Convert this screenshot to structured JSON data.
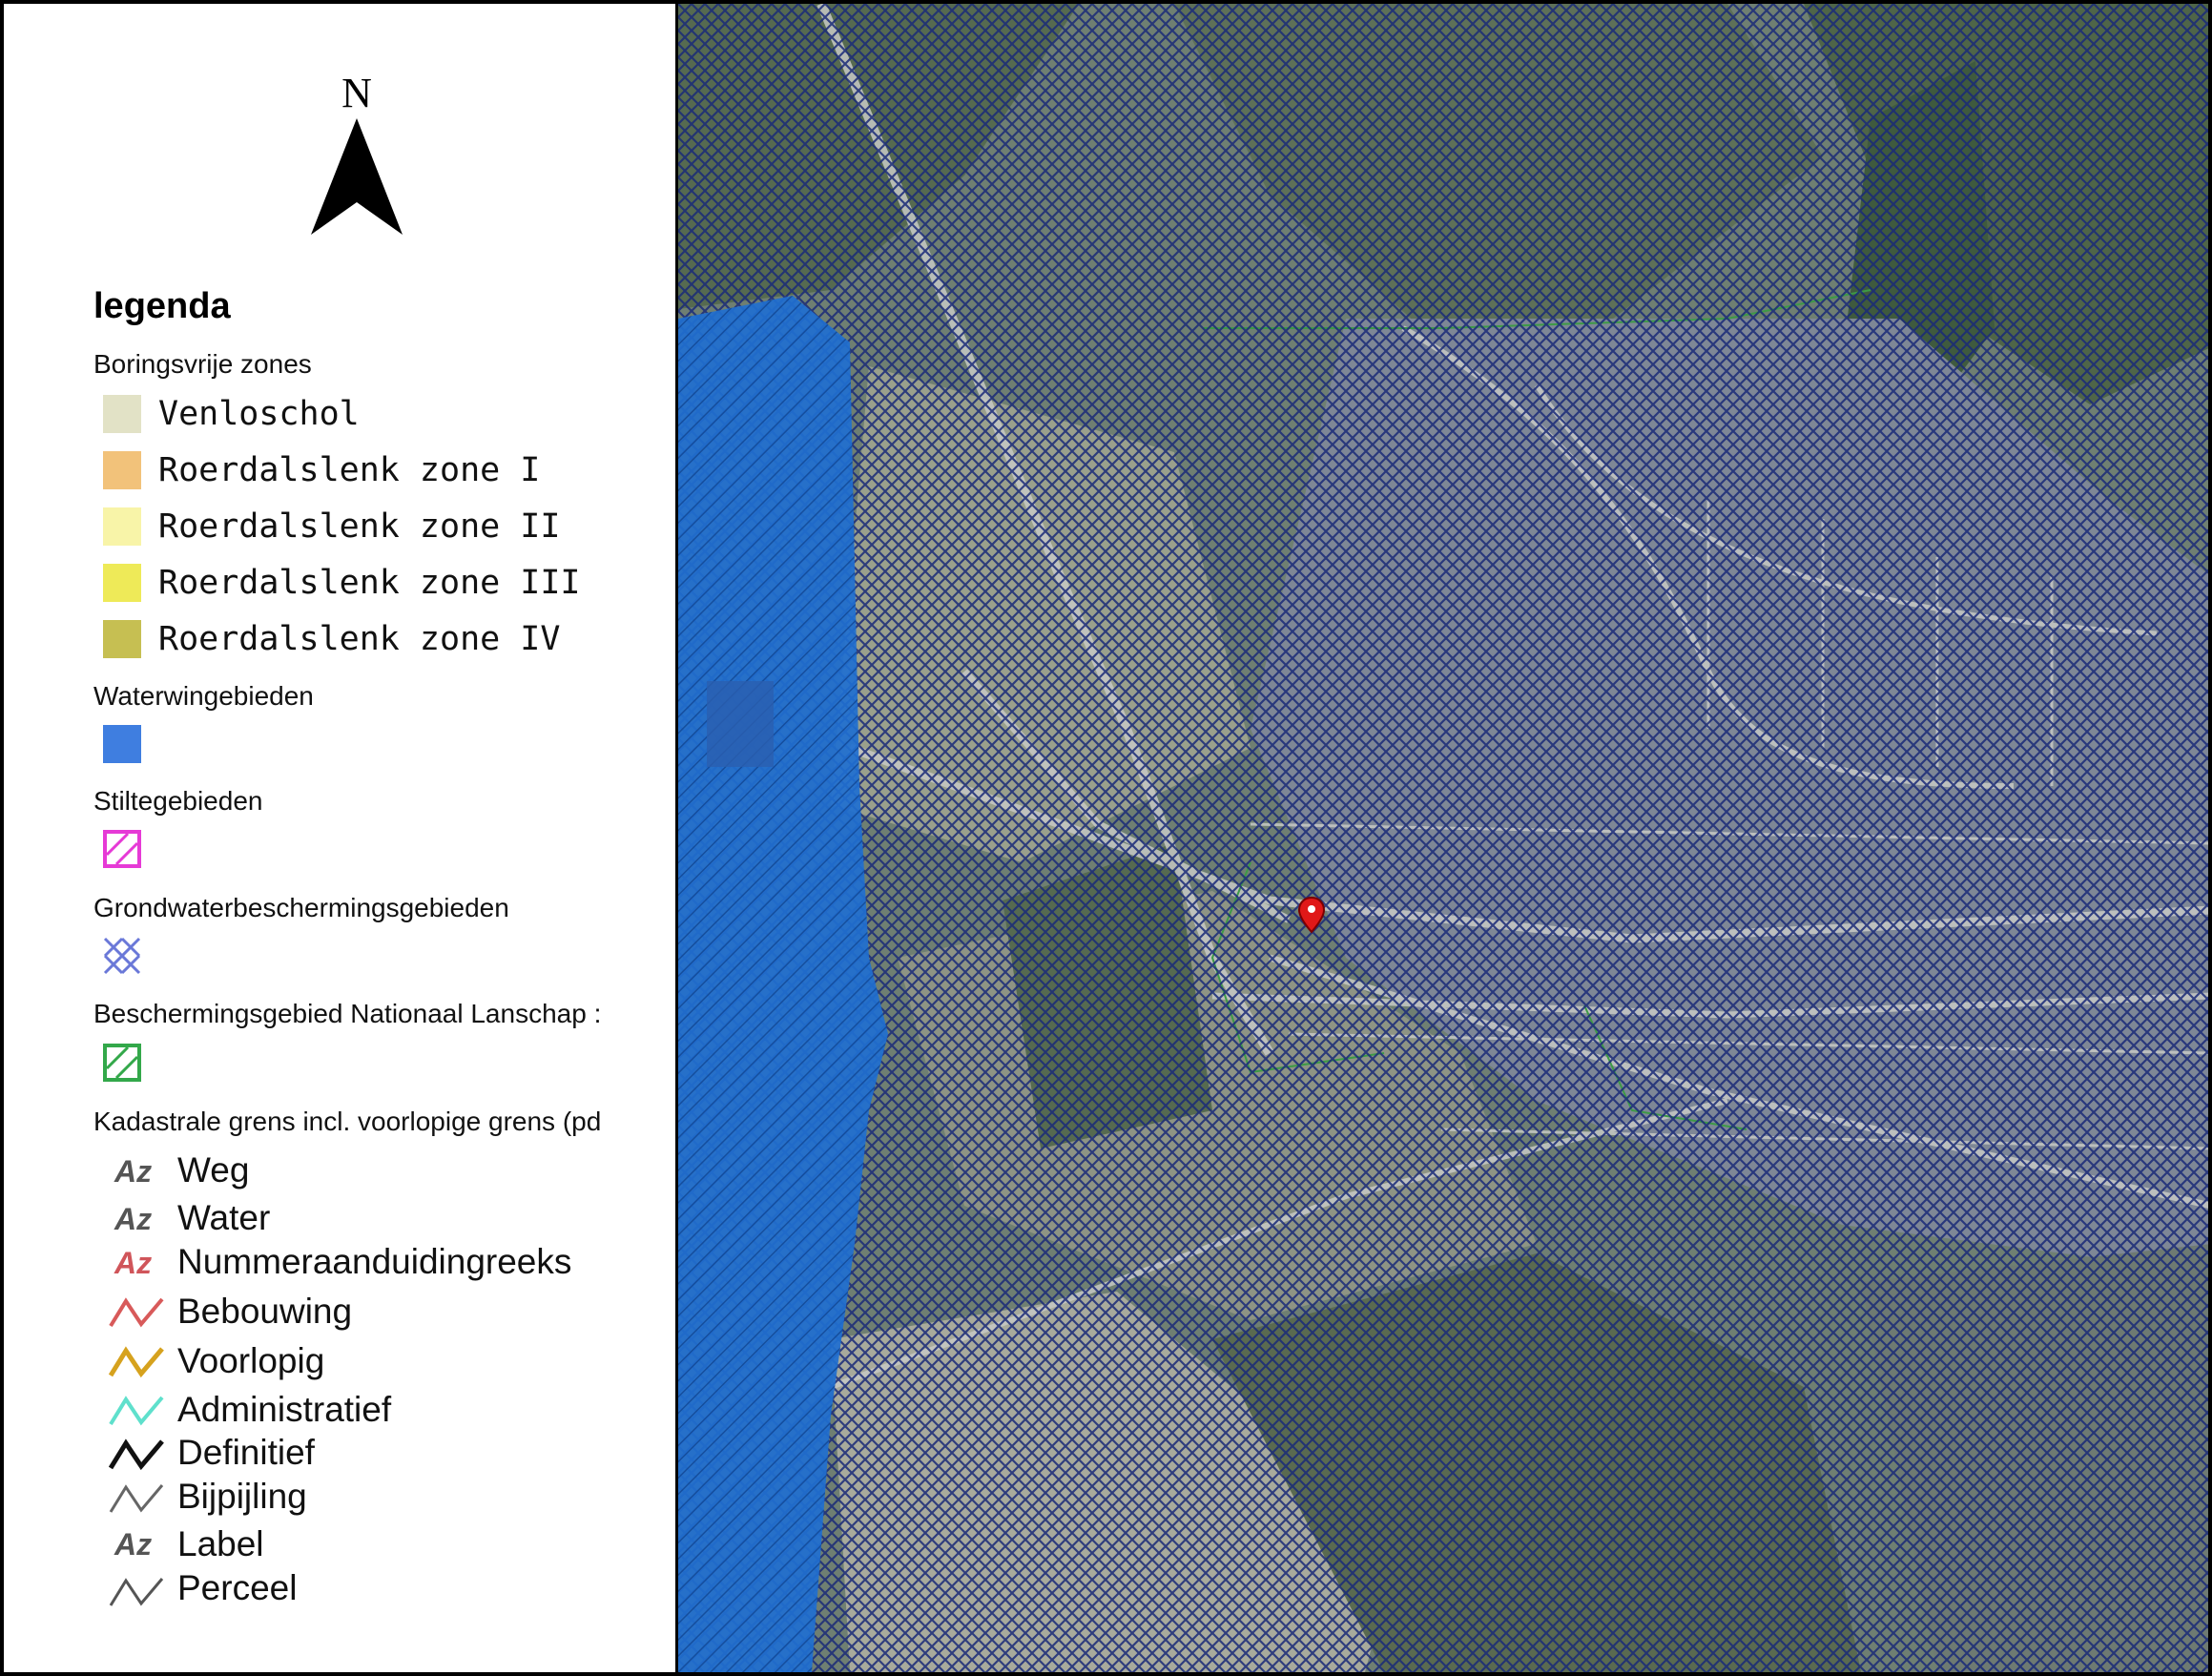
{
  "north_arrow": {
    "label": "N"
  },
  "legend": {
    "title": "legenda",
    "groups": {
      "boringsvrije": {
        "title": "Boringsvrije zones",
        "items": [
          {
            "label": "Venloschol",
            "color": "#e2e2c6"
          },
          {
            "label": "Roerdalslenk zone I",
            "color": "#f2c27a"
          },
          {
            "label": "Roerdalslenk zone II",
            "color": "#f8f4a8"
          },
          {
            "label": "Roerdalslenk zone III",
            "color": "#eeea58"
          },
          {
            "label": "Roerdalslenk zone IV",
            "color": "#c6bf52"
          }
        ]
      },
      "waterwingebieden": {
        "title": "Waterwingebieden",
        "color": "#3f7ee0"
      },
      "stiltegebieden": {
        "title": "Stiltegebieden",
        "color": "#e63ad6"
      },
      "grondwater": {
        "title": "Grondwaterbeschermingsgebieden",
        "color": "#6a78d8"
      },
      "nationaal_landschap": {
        "title": "Beschermingsgebied Nationaal Lanschap :",
        "color": "#33a84a"
      },
      "kadastraal": {
        "title": "Kadastrale grens incl. voorlopige grens (pd",
        "items": [
          {
            "label": "Weg",
            "icon": "az-text-icon",
            "color": "#555555"
          },
          {
            "label": "Water",
            "icon": "az-text-icon",
            "color": "#555555"
          },
          {
            "label": "Nummeraanduidingreeks",
            "icon": "az-text-icon",
            "color": "#d0555a"
          },
          {
            "label": "Bebouwing",
            "icon": "line-icon",
            "color": "#d85a5a"
          },
          {
            "label": "Voorlopig",
            "icon": "line-icon",
            "color": "#d6a21e"
          },
          {
            "label": "Administratief",
            "icon": "line-icon",
            "color": "#5fe0cc"
          },
          {
            "label": "Definitief",
            "icon": "line-icon",
            "color": "#111111"
          },
          {
            "label": "Bijpijling",
            "icon": "line-icon",
            "color": "#666666"
          },
          {
            "label": "Label",
            "icon": "az-text-icon",
            "color": "#555555"
          },
          {
            "label": "Perceel",
            "icon": "line-icon",
            "color": "#555555"
          }
        ]
      }
    }
  },
  "map": {
    "marker": {
      "icon": "map-pin-icon",
      "color": "#e01818"
    },
    "hatch_color": "#1a2a78",
    "waterwin_color": "#1f6fd0"
  }
}
